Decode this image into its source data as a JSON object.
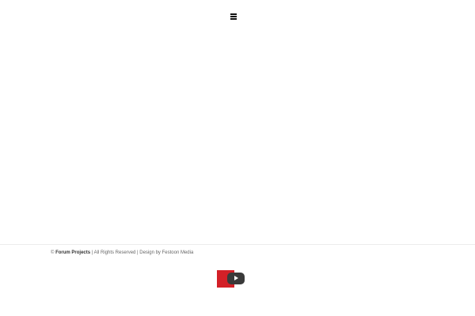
{
  "header": {
    "menu_icon": "hamburger-menu-icon"
  },
  "footer": {
    "copyright_symbol": "©",
    "brand": "Forum Projects",
    "rights": "| All Rights Reserved | Design by",
    "designer": "Festoon Media"
  },
  "video_widget": {
    "accent_color": "#d32027",
    "play_icon": "play-icon"
  }
}
